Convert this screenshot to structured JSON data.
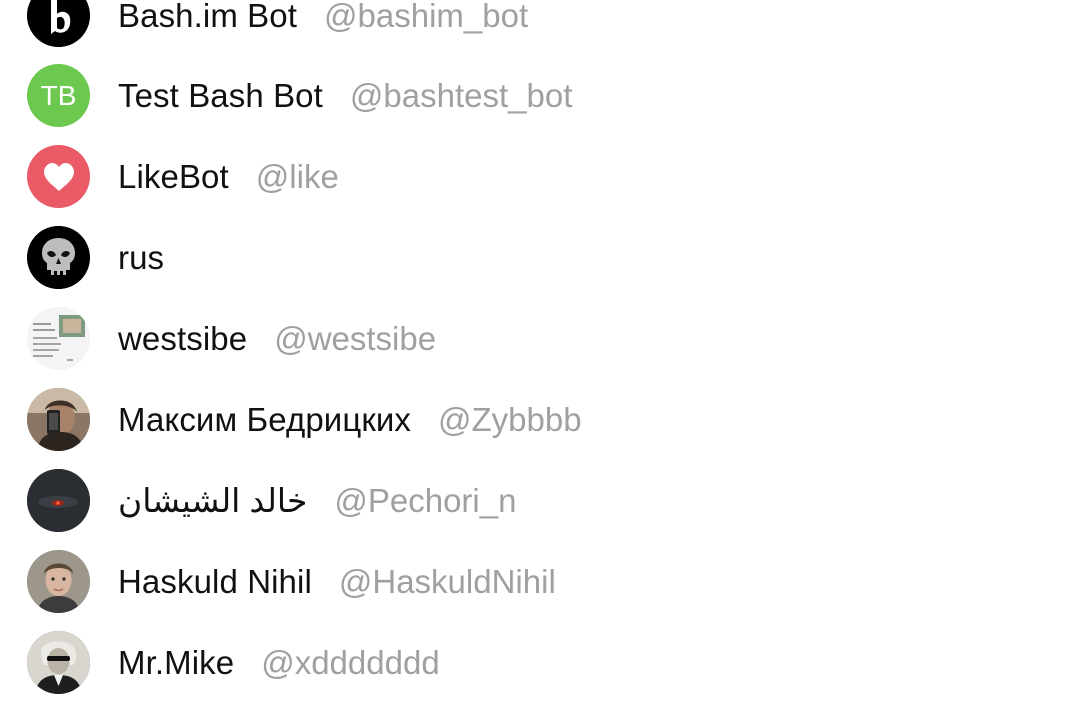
{
  "contacts": [
    {
      "name": "Bash.im Bot",
      "handle": "@bashim_bot",
      "avatar_icon": "bash-logo-icon",
      "avatar_color": "#000000"
    },
    {
      "name": "Test Bash Bot",
      "handle": "@bashtest_bot",
      "avatar_initials": "TB",
      "avatar_color": "#6cc84e"
    },
    {
      "name": "LikeBot",
      "handle": "@like",
      "avatar_icon": "heart-icon",
      "avatar_color": "#ea5a67"
    },
    {
      "name": "rus",
      "handle": "",
      "avatar_icon": "skull-icon",
      "avatar_color": "#000000"
    },
    {
      "name": "westsibe",
      "handle": "@westsibe",
      "avatar_icon": "photo-thumbnail",
      "avatar_color": "#f2f2f2"
    },
    {
      "name": "Максим Бедрицких",
      "handle": "@Zybbbb",
      "avatar_icon": "photo-selfie",
      "avatar_color": "#6b5a4c"
    },
    {
      "name": "خالد الشيشان",
      "handle": "@Pechori_n",
      "avatar_icon": "photo-dark",
      "avatar_color": "#2a2d31"
    },
    {
      "name": "Haskuld Nihil",
      "handle": "@HaskuldNihil",
      "avatar_icon": "photo-portrait",
      "avatar_color": "#8f8a7e"
    },
    {
      "name": "Mr.Mike",
      "handle": "@xddddddd",
      "avatar_icon": "photo-engraving",
      "avatar_color": "#3a3a3a"
    }
  ]
}
